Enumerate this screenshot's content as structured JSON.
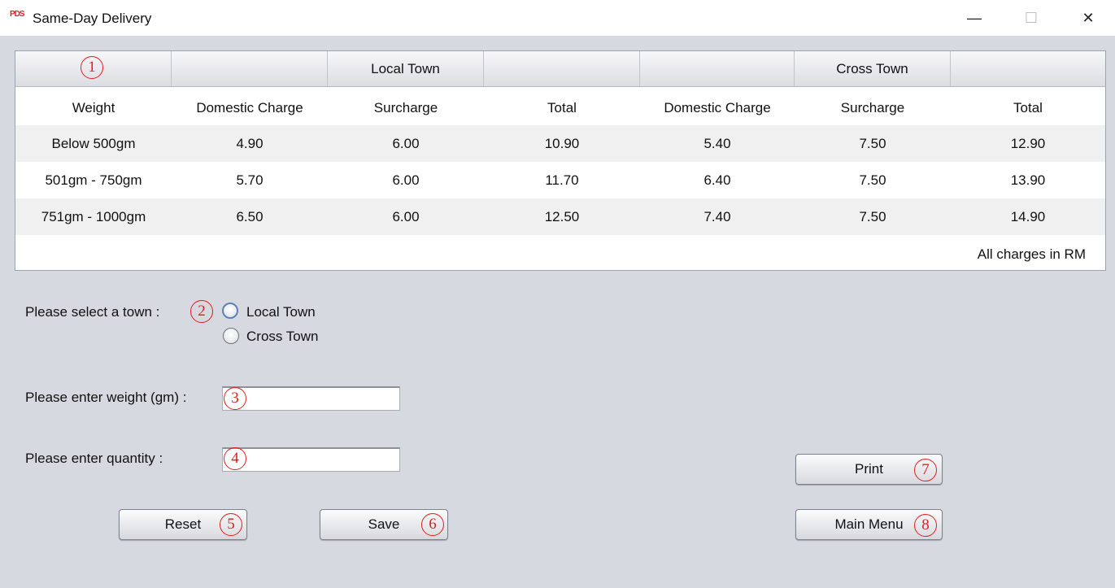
{
  "window": {
    "logo": "PDS",
    "title": "Same-Day Delivery",
    "minimize": "—",
    "maximize": "☐",
    "close": "✕"
  },
  "table": {
    "group_headers": [
      "",
      "",
      "Local Town",
      "",
      "",
      "Cross Town",
      ""
    ],
    "columns": [
      "Weight",
      "Domestic Charge",
      "Surcharge",
      "Total",
      "Domestic Charge",
      "Surcharge",
      "Total"
    ],
    "rows": [
      [
        "Below 500gm",
        "4.90",
        "6.00",
        "10.90",
        "5.40",
        "7.50",
        "12.90"
      ],
      [
        "501gm - 750gm",
        "5.70",
        "6.00",
        "11.70",
        "6.40",
        "7.50",
        "13.90"
      ],
      [
        "751gm - 1000gm",
        "6.50",
        "6.00",
        "12.50",
        "7.40",
        "7.50",
        "14.90"
      ]
    ],
    "note": "All charges in RM"
  },
  "form": {
    "town_label": "Please select a town :",
    "town_options": [
      "Local Town",
      "Cross Town"
    ],
    "weight_label": "Please enter weight (gm) :",
    "weight_value": "",
    "quantity_label": "Please enter quantity :",
    "quantity_value": ""
  },
  "buttons": {
    "reset": "Reset",
    "save": "Save",
    "print": "Print",
    "main_menu": "Main Menu"
  },
  "markers": [
    "1",
    "2",
    "3",
    "4",
    "5",
    "6",
    "7",
    "8"
  ],
  "colors": {
    "background": "#d6d9e0",
    "marker": "#e01d1d",
    "logo": "#d2232a"
  }
}
